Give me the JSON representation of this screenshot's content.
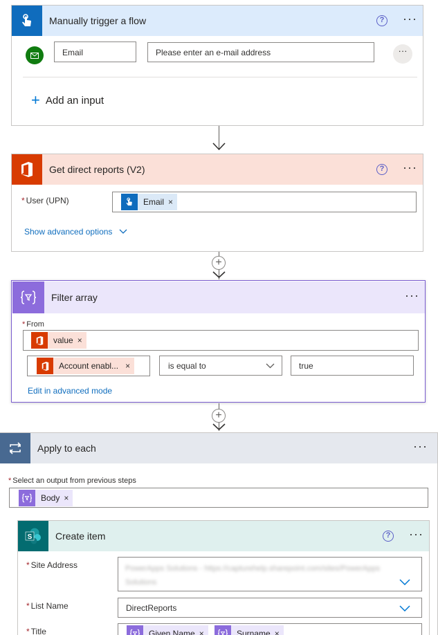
{
  "trigger": {
    "title": "Manually trigger a flow",
    "input_label": "Email",
    "input_placeholder": "Please enter an e-mail address",
    "add_input": "Add an input",
    "help": "?",
    "more": "···"
  },
  "get_reports": {
    "title": "Get direct reports (V2)",
    "field_label": "User (UPN)",
    "token": "Email",
    "advanced": "Show advanced options",
    "help": "?",
    "more": "···"
  },
  "filter": {
    "title": "Filter array",
    "from_label": "From",
    "from_token": "value",
    "cond_token": "Account enabl...",
    "operator": "is equal to",
    "value": "true",
    "advanced_mode": "Edit in advanced mode",
    "more": "···"
  },
  "apply_each": {
    "title": "Apply to each",
    "select_label": "Select an output from previous steps",
    "token": "Body",
    "more": "···"
  },
  "create_item": {
    "title": "Create item",
    "site_label": "Site Address",
    "site_value": "PowerApps Solutions - https://capturehelp.sharepoint.com/sites/PowerApps Solutions",
    "list_label": "List Name",
    "list_value": "DirectReports",
    "title_label": "Title",
    "title_token1": "Given Name",
    "title_token2": "Surname",
    "help": "?",
    "more": "···"
  },
  "common": {
    "token_x": "×",
    "required": "*",
    "plus": "+"
  },
  "colors": {
    "trigger_header": "#dcebfc",
    "trigger_icon": "#0f6cbd",
    "office_header": "#fbe0d8",
    "office_icon": "#d83b01",
    "filter_header": "#ebe6fb",
    "filter_icon": "#8c6cdc",
    "apply_header": "#e5e8ee",
    "apply_icon": "#486991",
    "sp_header": "#dff0ee",
    "sp_icon": "#036c70"
  }
}
